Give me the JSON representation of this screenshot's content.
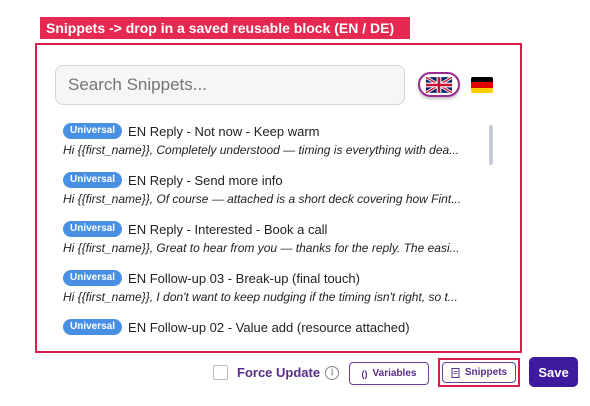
{
  "banner": "Snippets -> drop in a saved reusable block (EN / DE)",
  "search": {
    "placeholder": "Search Snippets..."
  },
  "language": {
    "selected": "en"
  },
  "snippets": [
    {
      "badge": "Universal",
      "title": "EN Reply - Not now - Keep warm",
      "preview": "Hi {{first_name}}, Completely understood — timing is everything with dea..."
    },
    {
      "badge": "Universal",
      "title": "EN Reply - Send more info",
      "preview": "Hi {{first_name}}, Of course — attached is a short deck covering how Fint..."
    },
    {
      "badge": "Universal",
      "title": "EN Reply - Interested - Book a call",
      "preview": "Hi {{first_name}}, Great to hear from you — thanks for the reply. The easi..."
    },
    {
      "badge": "Universal",
      "title": "EN Follow-up 03 - Break-up (final touch)",
      "preview": "Hi {{first_name}}, I don't want to keep nudging if the timing isn't right, so t..."
    },
    {
      "badge": "Universal",
      "title": "EN Follow-up 02 - Value add (resource attached)",
      "preview": ""
    }
  ],
  "footer": {
    "force_update": "Force Update",
    "info": "i",
    "variables": "Variables",
    "variables_icon": "()",
    "snippets": "Snippets",
    "save": "Save"
  },
  "colors": {
    "accent": "#d81f4c",
    "primary": "#3d1a9e",
    "badge": "#4a90e2"
  }
}
